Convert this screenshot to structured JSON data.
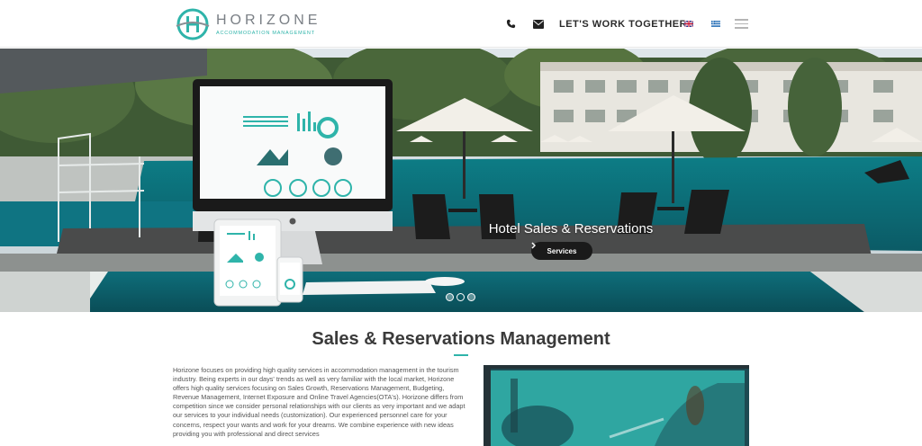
{
  "header": {
    "logo_name": "HORIZONE",
    "logo_tagline": "ACCOMMODATION MANAGEMENT",
    "cta_label": "LET'S WORK TOGETHER",
    "icons": [
      "phone-icon",
      "mail-icon",
      "flag-uk-icon",
      "flag-greece-icon",
      "hamburger-menu-icon"
    ]
  },
  "hero": {
    "title": "Hotel Sales & Reservations",
    "button_label": "Services",
    "slides": 3,
    "active_slide": 2
  },
  "main": {
    "title": "Sales & Reservations Management",
    "paragraph": "Horizone focuses on providing high quality services in accommodation management in the tourism industry. Being experts in our days' trends as well as very familiar with the local market, Horizone offers high quality services focusing on Sales Growth, Reservations Management, Budgeting, Revenue Management, Internet Exposure and Online Travel Agencies(OTA's). Horizone differs from competition since we consider personal relationships with our clients as very important and we adapt our services to your individual needs (customization). Our experienced personnel care for your concerns, respect your wants and work for your dreams. We combine experience with new ideas providing you with professional and direct services"
  },
  "colors": {
    "accent": "#2fb4aa",
    "text_dark": "#2b2b2b",
    "button_bg": "#1a1a1a"
  }
}
